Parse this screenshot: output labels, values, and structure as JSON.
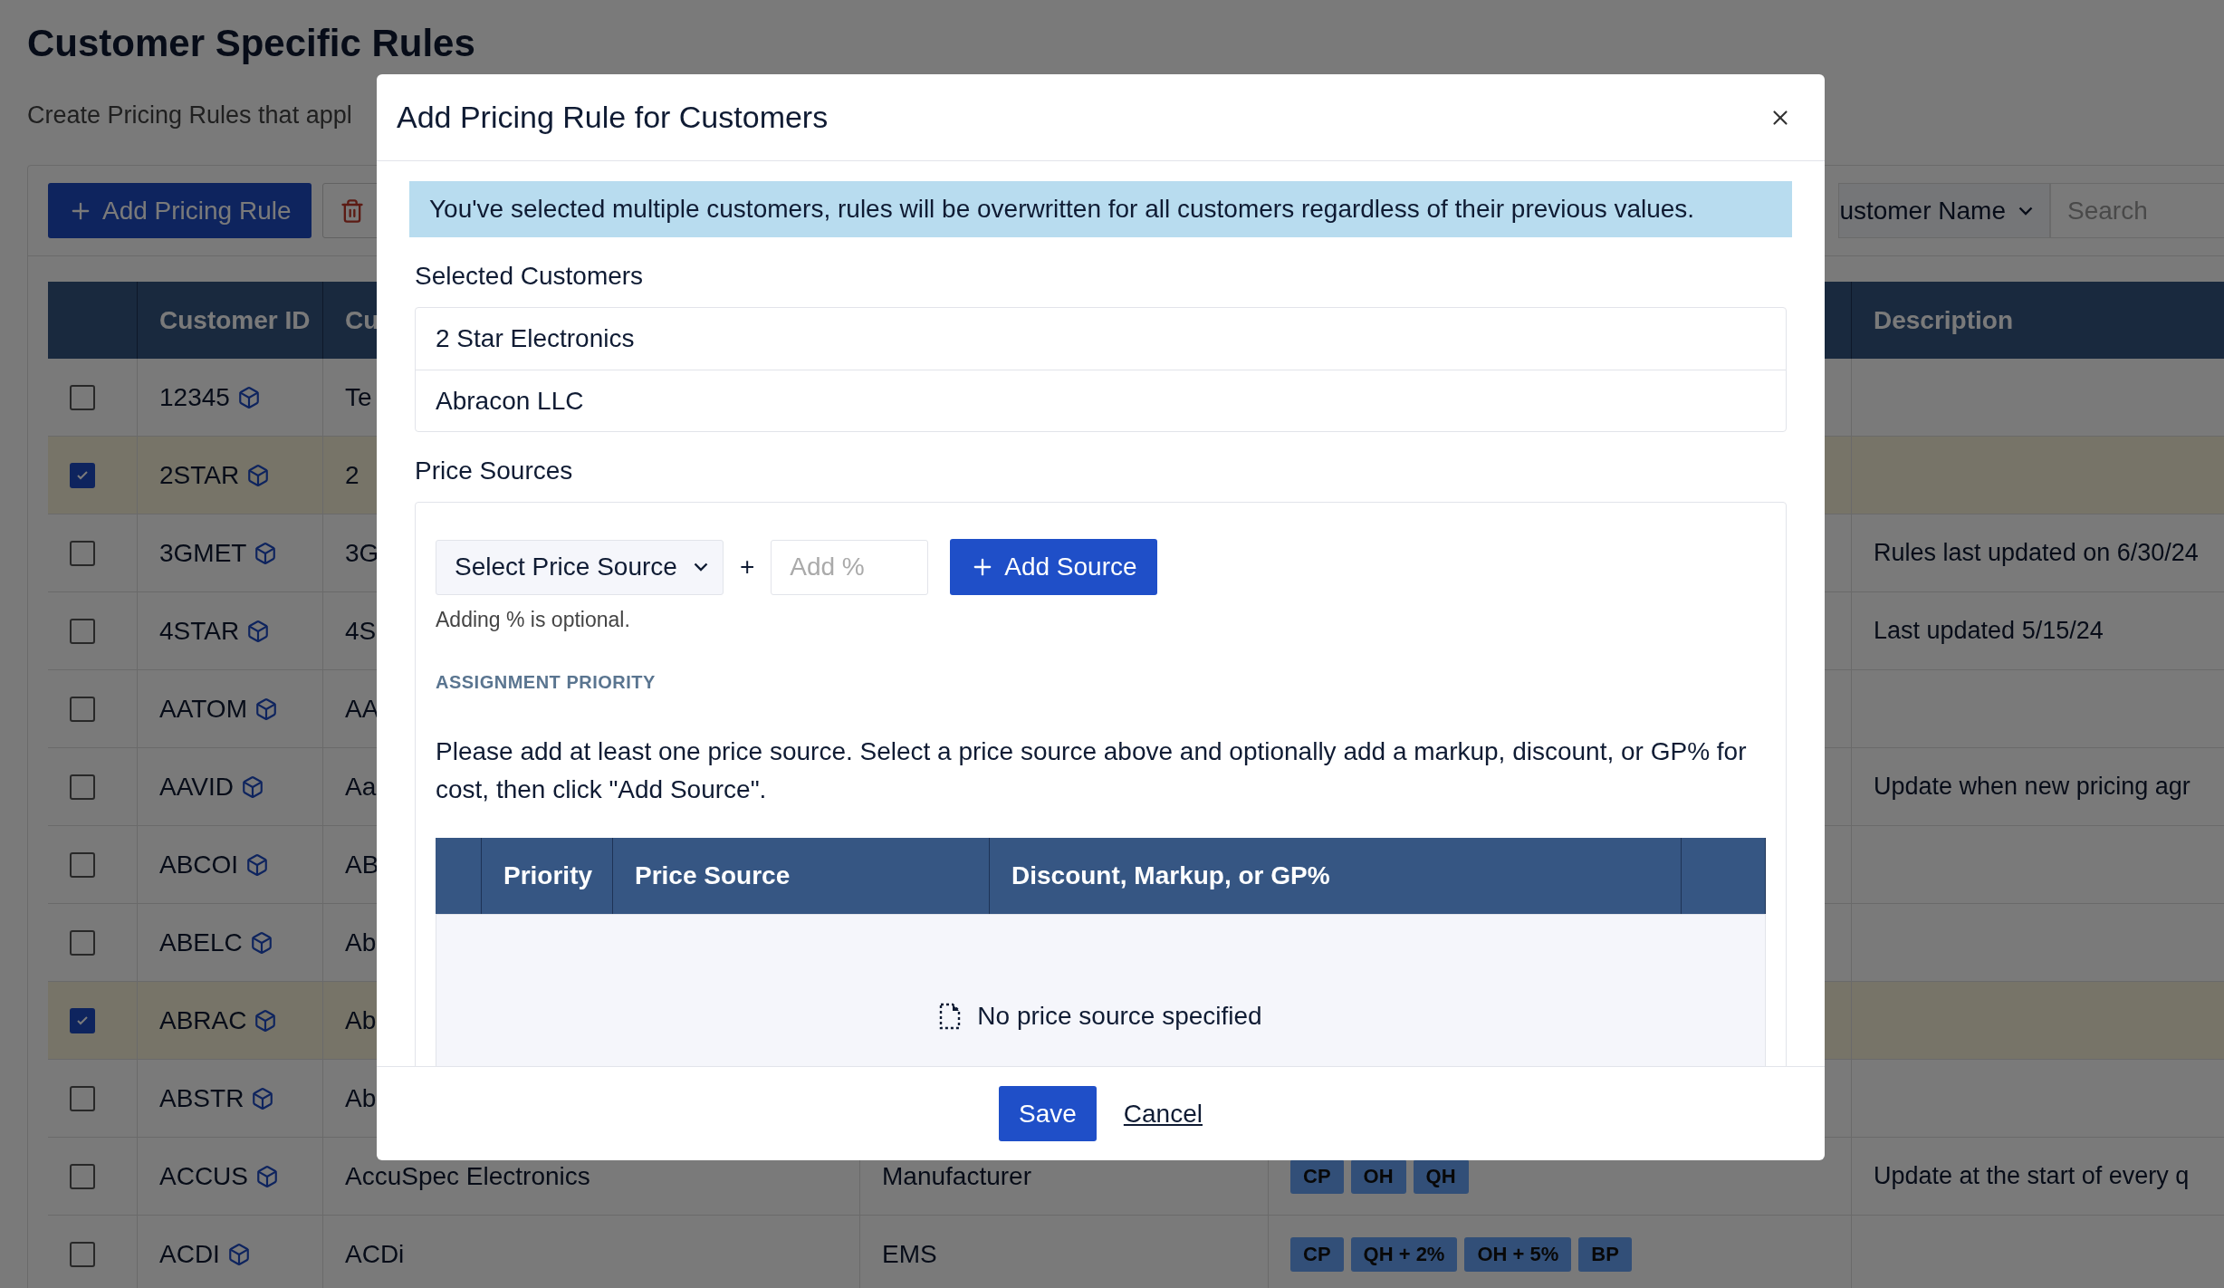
{
  "page": {
    "title": "Customer Specific Rules",
    "subtitle": "Create Pricing Rules that appl"
  },
  "toolbar": {
    "add_button": "Add Pricing Rule",
    "filter_select": "ustomer Name",
    "search": {
      "placeholder": "Search"
    }
  },
  "table": {
    "header": {
      "column_2": "Customer ID",
      "column_3": "Cu",
      "column_6": "Description"
    },
    "rows": [
      {
        "id": "12345",
        "column_3": "Te",
        "checked": false
      },
      {
        "id": "2STAR",
        "column_3": "2",
        "checked": true
      },
      {
        "id": "3GMET",
        "column_3": "3G",
        "description": "Rules last updated on 6/30/24",
        "checked": false
      },
      {
        "id": "4STAR",
        "column_3": "4S",
        "description": "Last updated 5/15/24",
        "checked": false
      },
      {
        "id": "AATOM",
        "column_3": "AA",
        "checked": false
      },
      {
        "id": "AAVID",
        "column_3": "Aa",
        "description": "Update when new pricing agr",
        "checked": false
      },
      {
        "id": "ABCOI",
        "column_3": "AB",
        "checked": false
      },
      {
        "id": "ABELC",
        "column_3": "Ab",
        "checked": false
      },
      {
        "id": "ABRAC",
        "column_3": "Ab",
        "checked": true
      },
      {
        "id": "ABSTR",
        "column_3": "Ab",
        "checked": false
      },
      {
        "id": "ACCUS",
        "column_3": "AccuSpec Electronics",
        "column_4": "Manufacturer",
        "tags": [
          "CP",
          "OH",
          "QH"
        ],
        "description": "Update at the start of every q",
        "checked": false
      },
      {
        "id": "ACDI",
        "column_3": "ACDi",
        "column_4": "EMS",
        "tags": [
          "CP",
          "QH + 2%",
          "OH + 5%",
          "BP"
        ],
        "checked": false
      }
    ]
  },
  "modal": {
    "title": "Add Pricing Rule for Customers",
    "alert": "You've selected multiple customers, rules will be overwritten for all customers regardless of their previous values.",
    "selected_label": "Selected Customers",
    "selected_customers": [
      "2 Star Electronics",
      "Abracon LLC"
    ],
    "price_sources": {
      "label": "Price Sources",
      "select": "Select Price Source",
      "plus": "+",
      "percent": {
        "placeholder": "Add %"
      },
      "add_button": "Add Source",
      "hint": "Adding % is optional.",
      "section_label": "ASSIGNMENT PRIORITY",
      "message": "Please add at least one price source. Select a price source above and optionally add a markup, discount, or GP% for cost, then click \"Add Source\".",
      "table": {
        "columns": [
          "Priority",
          "Price Source",
          "Discount, Markup, or GP%"
        ],
        "empty": "No price source specified"
      }
    },
    "footer": {
      "save": "Save",
      "cancel": "Cancel"
    }
  }
}
